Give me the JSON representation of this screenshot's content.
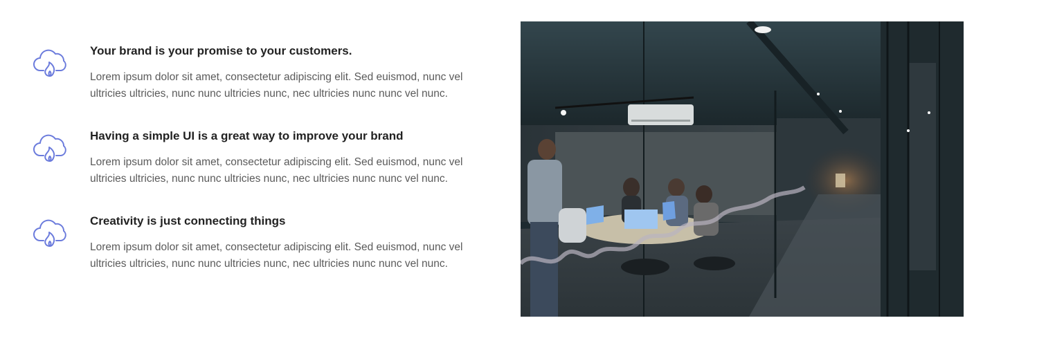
{
  "colors": {
    "icon_stroke": "#6b7bdc",
    "heading": "#222222",
    "body": "#5a5a5a"
  },
  "features": [
    {
      "icon": "cloud-fire-icon",
      "title": "Your brand is your promise to your customers.",
      "body": "Lorem ipsum dolor sit amet, consectetur adipiscing elit. Sed euismod, nunc vel ultricies ultricies, nunc nunc ultricies nunc, nec ultricies nunc nunc vel nunc."
    },
    {
      "icon": "cloud-fire-icon",
      "title": "Having a simple UI is a great way to improve your brand",
      "body": "Lorem ipsum dolor sit amet, consectetur adipiscing elit. Sed euismod, nunc vel ultricies ultricies, nunc nunc ultricies nunc, nec ultricies nunc nunc vel nunc."
    },
    {
      "icon": "cloud-fire-icon",
      "title": "Creativity is just connecting things",
      "body": "Lorem ipsum dolor sit amet, consectetur adipiscing elit. Sed euismod, nunc vel ultricies ultricies, nunc nunc ultricies nunc, nec ultricies nunc nunc vel nunc."
    }
  ],
  "photo": {
    "subject": "office-meeting-photo"
  }
}
